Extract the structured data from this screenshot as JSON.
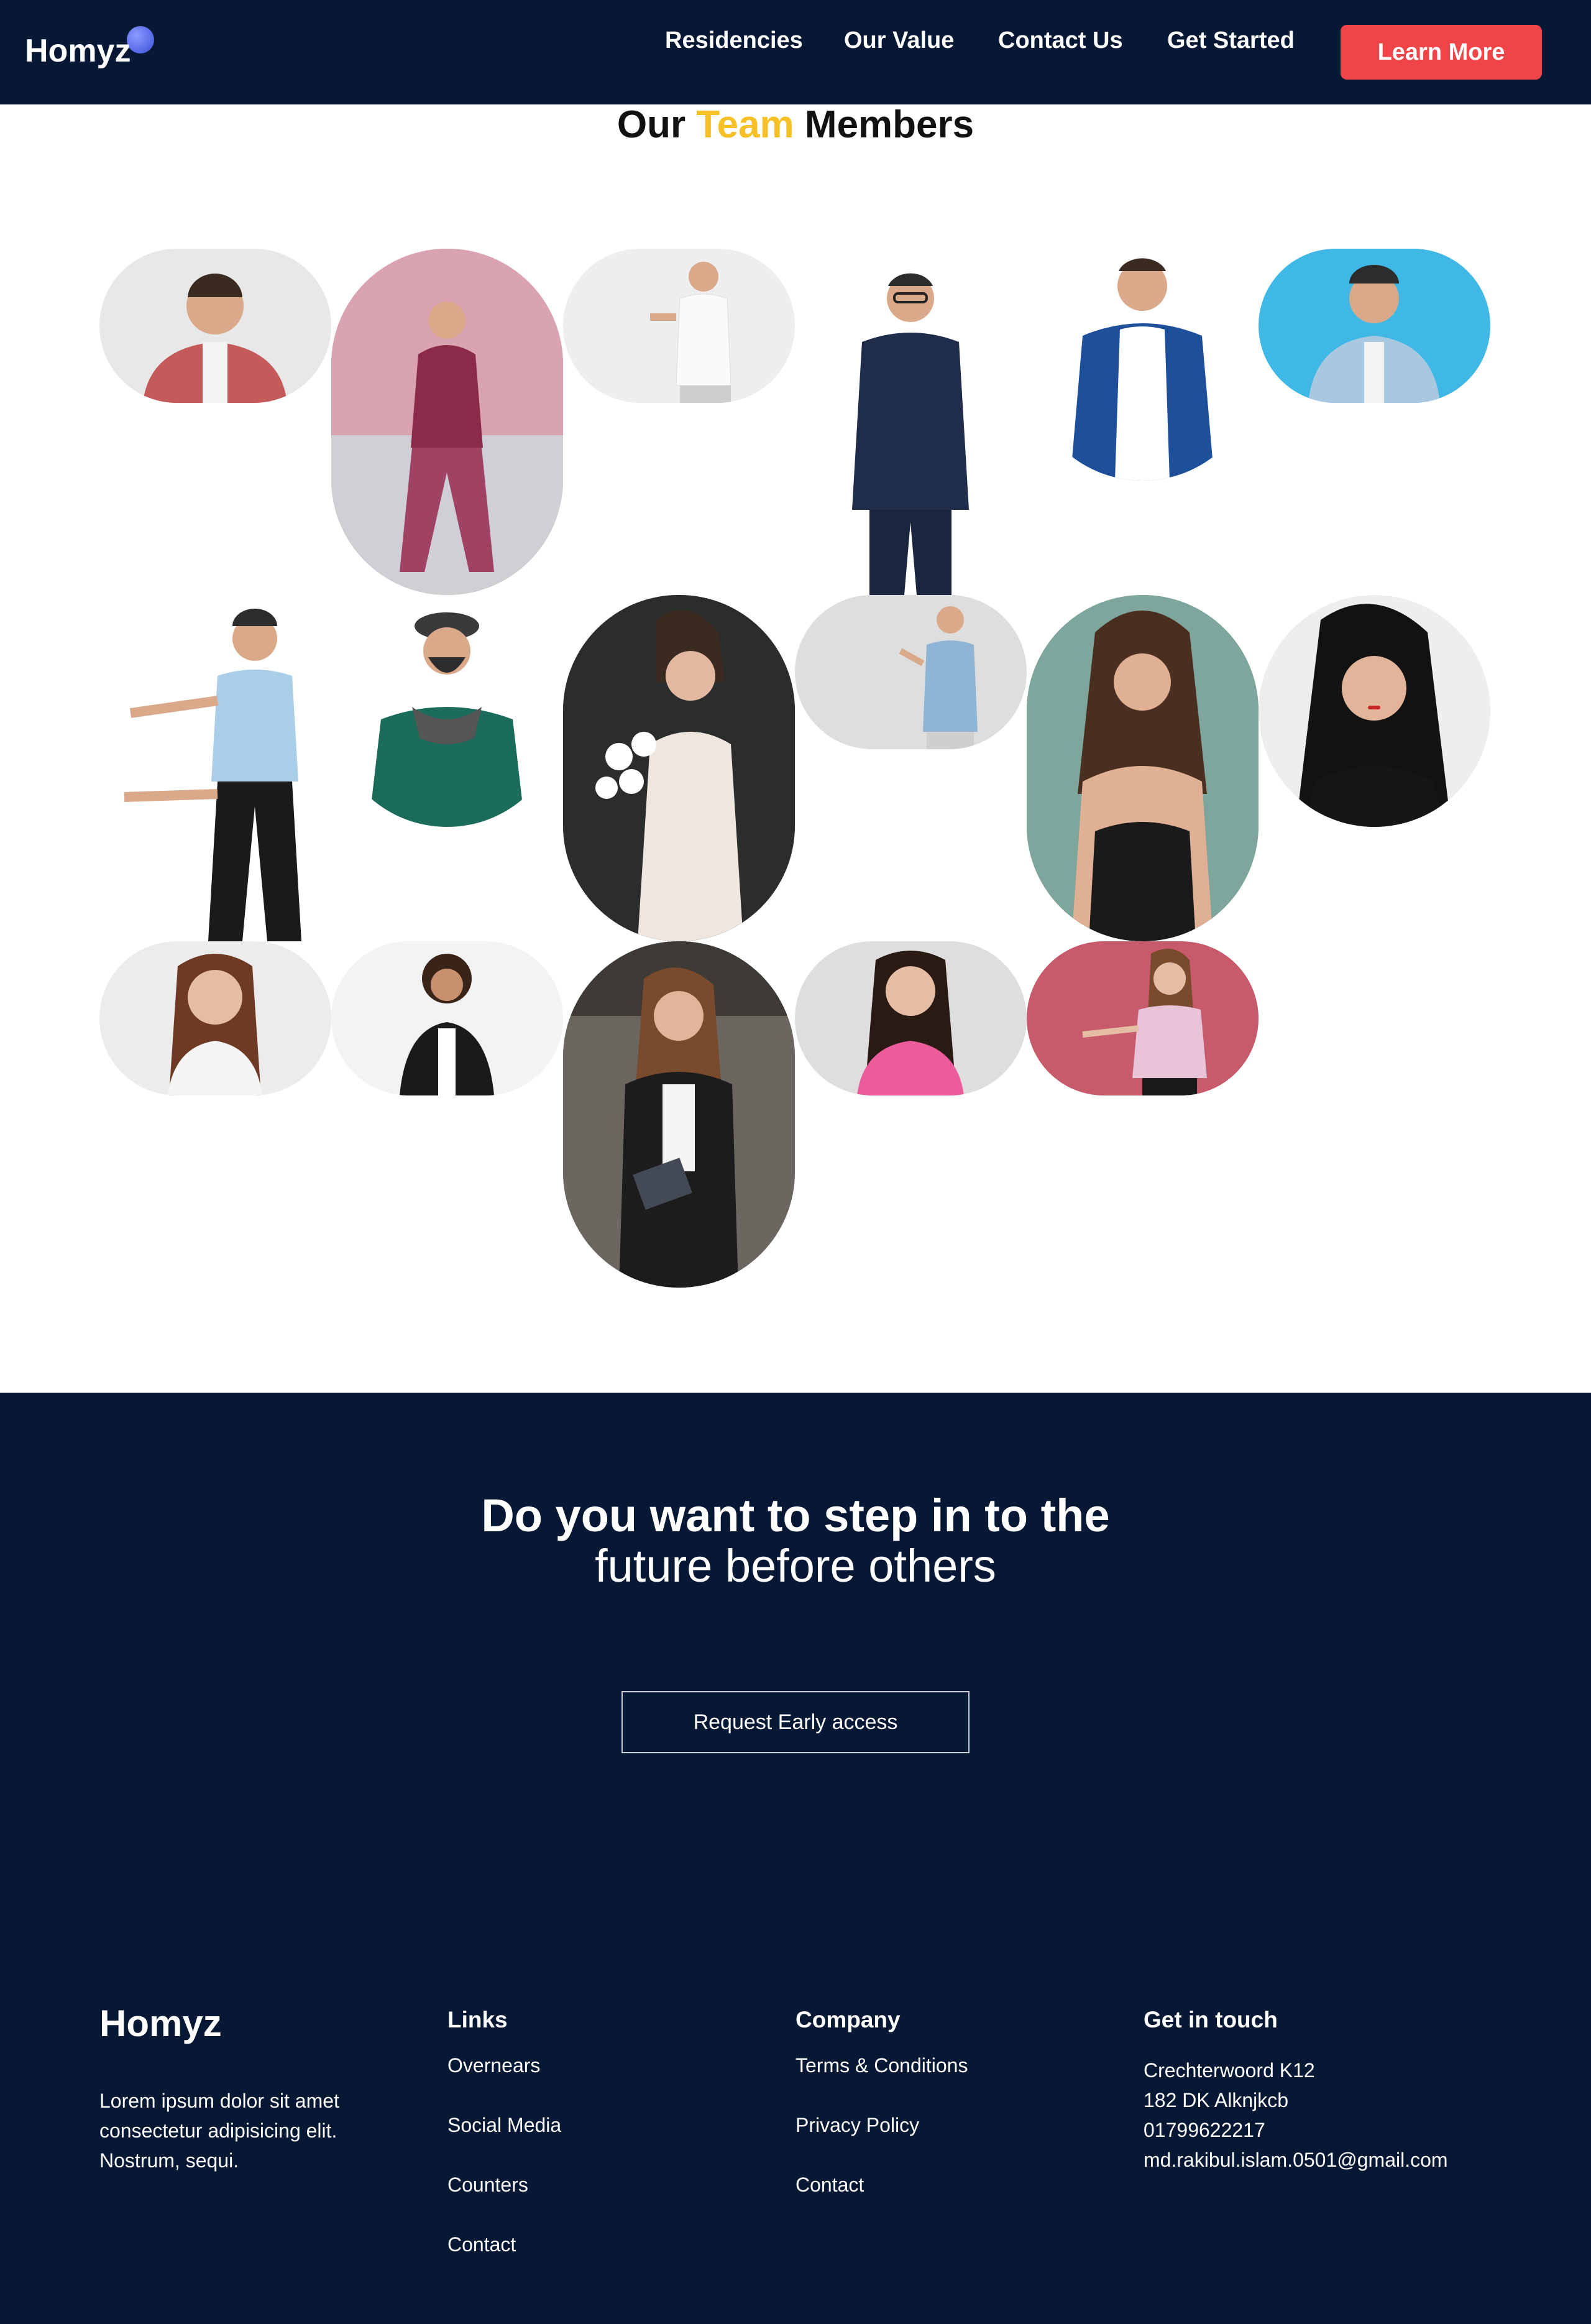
{
  "header": {
    "logo": "Homyz",
    "nav": [
      "Residencies",
      "Our Value",
      "Contact Us",
      "Get Started"
    ],
    "cta_label": "Learn More"
  },
  "team": {
    "title_before": "Our",
    "title_accent": "Team",
    "title_after": "Members"
  },
  "cta": {
    "line1": "Do you want to step in to the",
    "line2": "future before others",
    "button_label": "Request Early access"
  },
  "footer": {
    "brand": "Homyz",
    "description": "Lorem ipsum dolor sit amet consectetur adipisicing elit. Nostrum, sequi.",
    "links_heading": "Links",
    "links": [
      "Overnears",
      "Social Media",
      "Counters",
      "Contact"
    ],
    "company_heading": "Company",
    "company": [
      "Terms & Conditions",
      "Privacy Policy",
      "Contact"
    ],
    "contact_heading": "Get in touch",
    "contact": [
      "Crechterwoord K12",
      "182 DK Alknjkcb",
      "01799622217",
      "md.rakibul.islam.0501@gmail.com"
    ]
  },
  "colors": {
    "navy": "#061833",
    "accent_yellow": "#f6c026",
    "button_red": "#ef4448"
  }
}
